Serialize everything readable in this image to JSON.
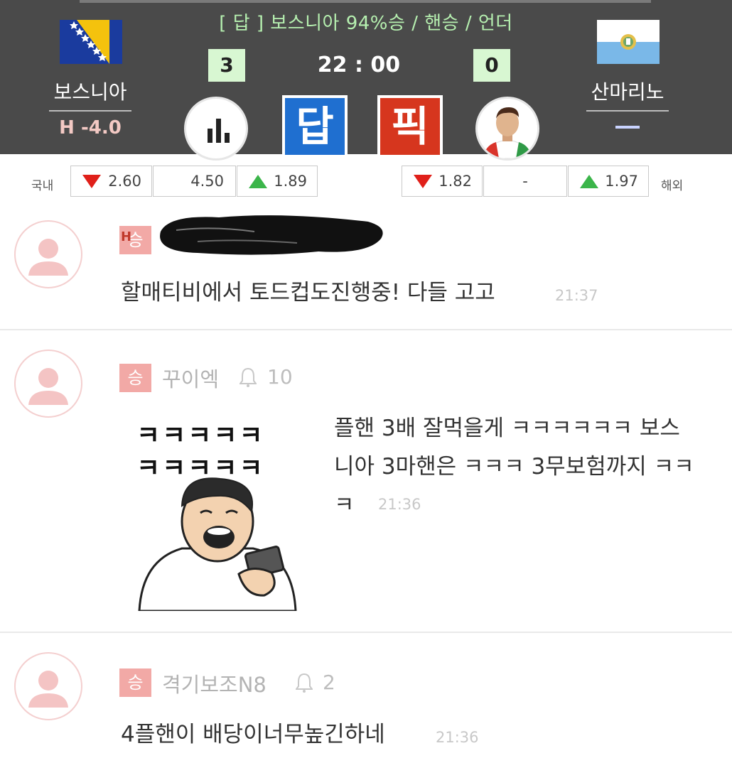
{
  "header": {
    "headline": "[ 답 ] 보스니아  94%승 / 핸승 / 언더",
    "home_team": "보스니아",
    "away_team": "산마리노",
    "home_handicap": "H -4.0",
    "home_score": "3",
    "away_score": "0",
    "match_time": "22 : 00",
    "answer_button": "답",
    "pick_button": "픽",
    "home_flag_icon": "bosnia-flag-icon",
    "away_flag_icon": "san-marino-flag-icon"
  },
  "odds": {
    "domestic_label": "국내",
    "overseas_label": "해외",
    "domestic": {
      "home": "2.60",
      "draw": "4.50",
      "away": "1.89"
    },
    "overseas": {
      "home": "1.82",
      "draw": "-",
      "away": "1.97"
    }
  },
  "comments": [
    {
      "badge": "승",
      "badge_prefix": "H",
      "nickname": "",
      "likes": "",
      "text": "할매티비에서 토드컵도진행중! 다들 고고",
      "time": "21:37"
    },
    {
      "badge": "승",
      "badge_prefix": "",
      "nickname": "꾸이엑",
      "likes": "10",
      "text_line1": "플핸 3배 잘먹을게 ㅋㅋㅋㅋㅋㅋ 보스",
      "text_line2": "니아 3마핸은 ㅋㅋㅋ 3무보험까지 ㅋㅋ",
      "text_line3": "ㅋ",
      "time": "21:36",
      "sticker_text1": "ㅋㅋㅋㅋㅋ",
      "sticker_text2": "ㅋㅋㅋㅋㅋ"
    },
    {
      "badge": "승",
      "badge_prefix": "",
      "nickname": "격기보조N8",
      "likes": "2",
      "text": "4플핸이 배당이너무높긴하네",
      "time": "21:36"
    }
  ],
  "colors": {
    "header_bg": "#4a4a4a",
    "headline": "#b6f0b0",
    "score_bg": "#d8f7d2",
    "answer_blue": "#1f6fd0",
    "pick_red": "#d6361e",
    "badge_pink": "#f2a9a6",
    "down_red": "#e0201a",
    "up_green": "#3bb54a"
  }
}
